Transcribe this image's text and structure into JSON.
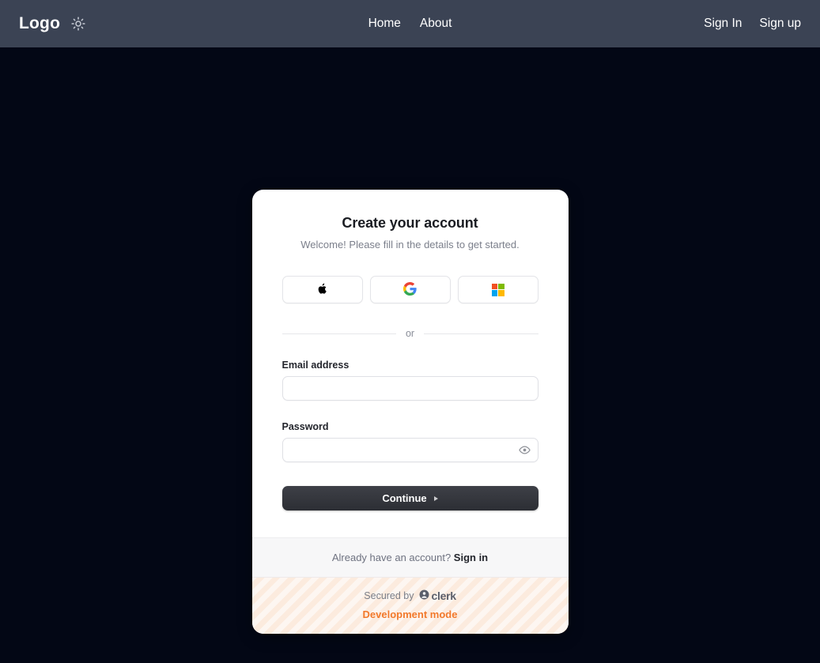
{
  "navbar": {
    "brand": "Logo",
    "theme_toggle_icon": "sun-icon",
    "center_links": [
      {
        "label": "Home"
      },
      {
        "label": "About"
      }
    ],
    "right_links": [
      {
        "label": "Sign In"
      },
      {
        "label": "Sign up"
      }
    ]
  },
  "card": {
    "title": "Create your account",
    "subtitle": "Welcome! Please fill in the details to get started.",
    "social_buttons": [
      {
        "provider": "apple",
        "icon": "apple-icon"
      },
      {
        "provider": "google",
        "icon": "google-icon"
      },
      {
        "provider": "microsoft",
        "icon": "microsoft-icon"
      }
    ],
    "divider_label": "or",
    "fields": {
      "email": {
        "label": "Email address",
        "value": "",
        "placeholder": ""
      },
      "password": {
        "label": "Password",
        "value": "",
        "placeholder": "",
        "reveal_icon": "eye-icon"
      }
    },
    "submit": {
      "label": "Continue",
      "caret_icon": "caret-right-icon"
    },
    "footer": {
      "prompt": "Already have an account?",
      "link": "Sign in"
    },
    "dev_strip": {
      "secured_by": "Secured by",
      "brand": "clerk",
      "brand_icon": "clerk-logo-icon",
      "status": "Development mode"
    }
  },
  "colors": {
    "page_background": "#030715",
    "navbar_background": "#3b4354",
    "card_background": "#ffffff",
    "submit_background": "#2c2e34",
    "dev_mode_text": "#f2792b",
    "microsoft_red": "#f25022",
    "microsoft_green": "#7fba00",
    "microsoft_blue": "#00a4ef",
    "microsoft_yellow": "#ffb900"
  }
}
